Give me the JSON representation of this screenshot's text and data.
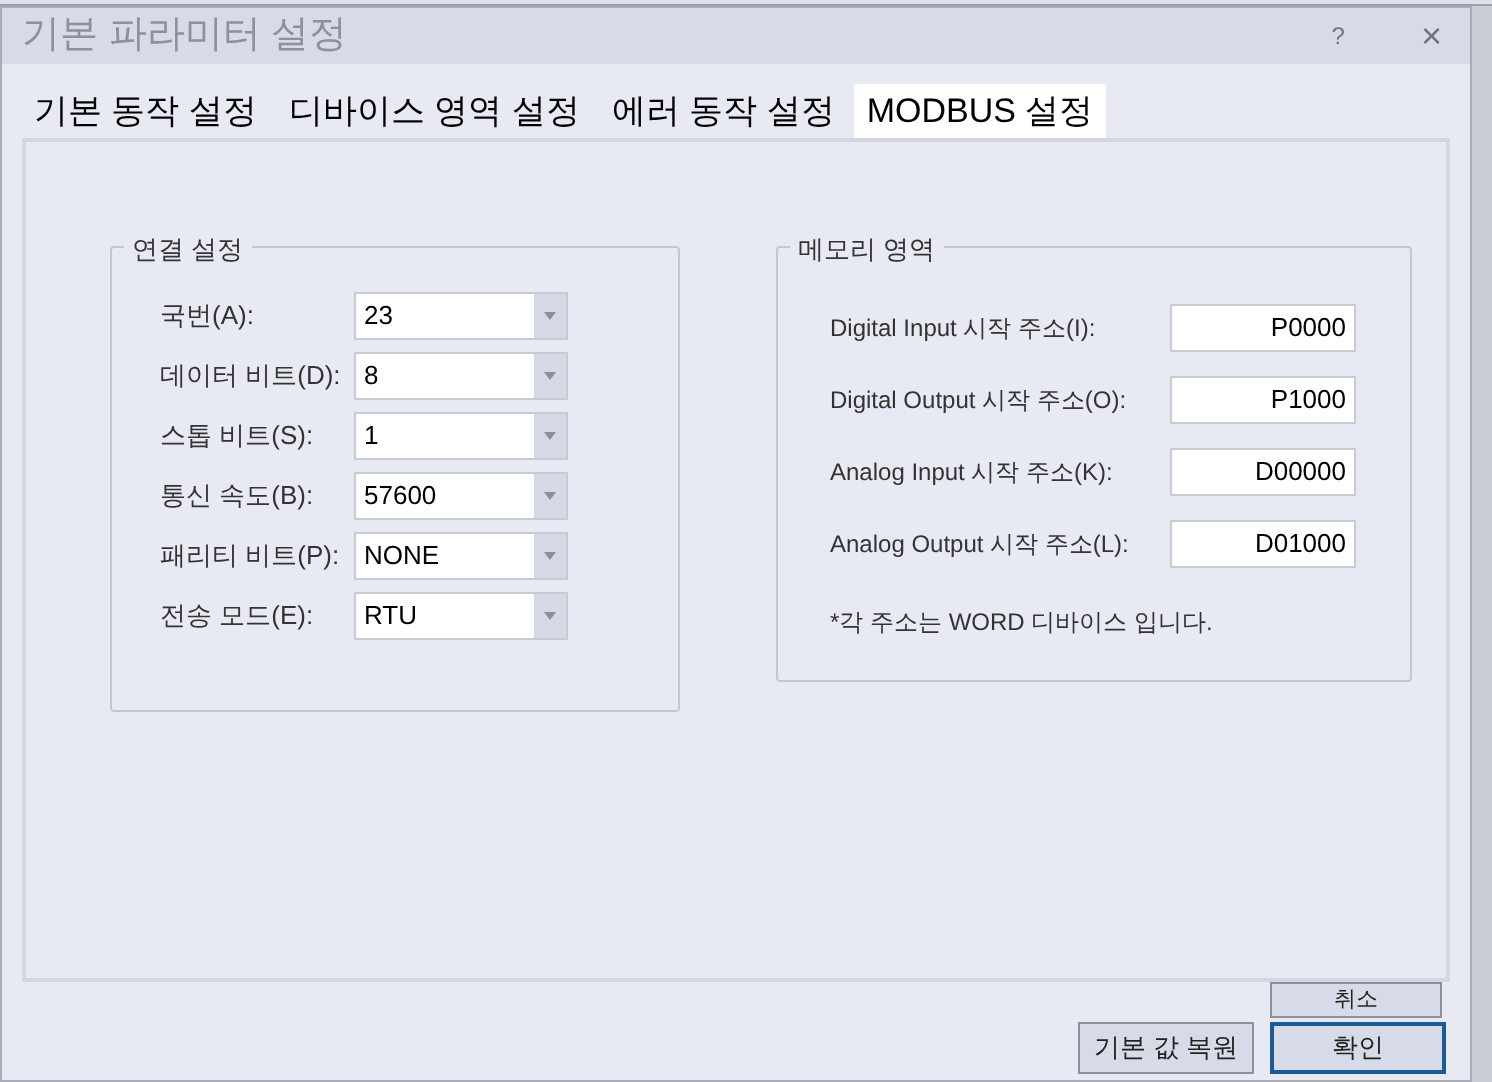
{
  "window": {
    "title": "기본 파라미터 설정",
    "help": "?",
    "close": "×"
  },
  "tabs": [
    {
      "label": "기본 동작 설정",
      "selected": false
    },
    {
      "label": "디바이스 영역 설정",
      "selected": false
    },
    {
      "label": "에러 동작 설정",
      "selected": false
    },
    {
      "label": "MODBUS 설정",
      "selected": true
    }
  ],
  "connection": {
    "title": "연결 설정",
    "fields": [
      {
        "label": "국번(A):",
        "value": "23"
      },
      {
        "label": "데이터 비트(D):",
        "value": "8"
      },
      {
        "label": "스톱 비트(S):",
        "value": "1"
      },
      {
        "label": "통신 속도(B):",
        "value": "57600"
      },
      {
        "label": "패리티 비트(P):",
        "value": "NONE"
      },
      {
        "label": "전송 모드(E):",
        "value": "RTU"
      }
    ]
  },
  "memory": {
    "title": "메모리 영역",
    "fields": [
      {
        "label": "Digital Input 시작 주소(I):",
        "value": "P0000"
      },
      {
        "label": "Digital Output 시작 주소(O):",
        "value": "P1000"
      },
      {
        "label": "Analog Input 시작 주소(K):",
        "value": "D00000"
      },
      {
        "label": "Analog Output 시작 주소(L):",
        "value": "D01000"
      }
    ],
    "note": "*각 주소는 WORD 디바이스 입니다."
  },
  "buttons": {
    "cancel": "취소",
    "restore": "기본 값 복원",
    "ok": "확인"
  }
}
